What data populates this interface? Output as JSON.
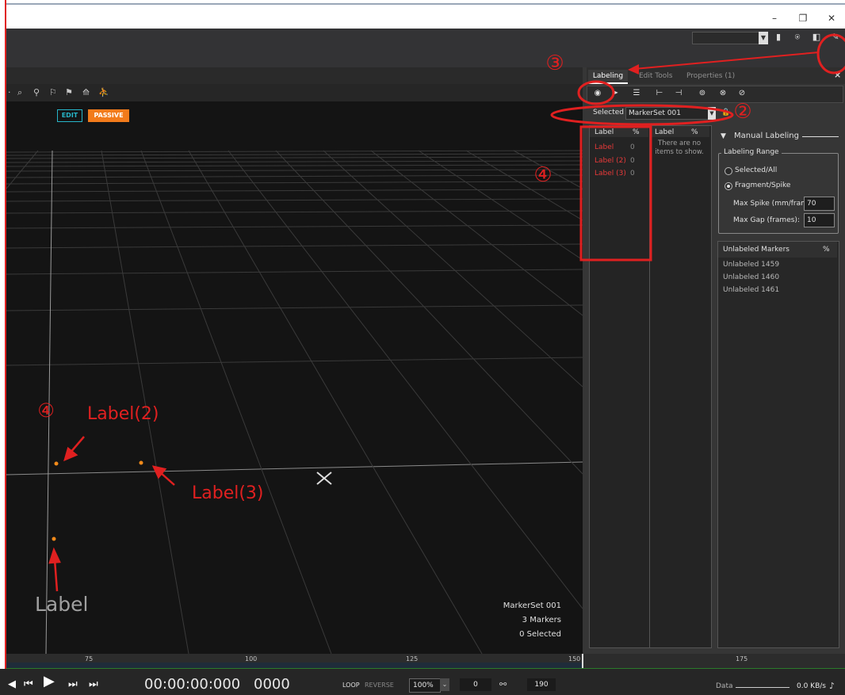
{
  "window": {
    "minimize_icon": "minimize-icon",
    "restore_icon": "restore-icon",
    "close_icon": "close-icon"
  },
  "viewport": {
    "edit_badge": "EDIT",
    "passive_badge": "PASSIVE",
    "marker_set_name": "MarkerSet 001",
    "marker_count": "3 Markers",
    "selected_count": "0 Selected"
  },
  "panel": {
    "tabs": [
      {
        "label": "Labeling"
      },
      {
        "label": "Edit Tools"
      },
      {
        "label": "Properties (1)"
      }
    ],
    "close": "×",
    "selected_label": "Selected",
    "selected_value": "MarkerSet 001",
    "label_list": {
      "header_label": "Label",
      "header_pct": "%",
      "rows": [
        {
          "label": "Label",
          "pct": "0"
        },
        {
          "label": "Label (2)",
          "pct": "0"
        },
        {
          "label": "Label (3)",
          "pct": "0"
        }
      ]
    },
    "secondary_list": {
      "header_label": "Label",
      "header_pct": "%",
      "empty_text": "There are no items to show."
    },
    "manual_labeling": {
      "title": "Manual Labeling",
      "range_title": "Labeling Range",
      "option_selected_all": "Selected/All",
      "option_fragment": "Fragment/Spike",
      "max_spike_label": "Max Spike (mm/frame):",
      "max_spike_value": "70",
      "max_gap_label": "Max Gap (frames):",
      "max_gap_value": "10"
    },
    "unlabeled": {
      "header": "Unlabeled Markers",
      "header_pct": "%",
      "rows": [
        "Unlabeled 1459",
        "Unlabeled 1460",
        "Unlabeled 1461"
      ]
    }
  },
  "timeline": {
    "ticks": [
      "75",
      "100",
      "125",
      "150",
      "175"
    ]
  },
  "transport": {
    "timecode": "00:00:00:000",
    "frame": "0000",
    "loop": "LOOP",
    "reverse": "REVERSE",
    "speed": "100%",
    "start_frame": "0",
    "end_frame": "190",
    "data_label": "Data",
    "data_rate": "0.0 KB/s"
  },
  "annotations": {
    "circle_2": "②",
    "circle_3": "③",
    "circle_4a": "④",
    "circle_4b": "④",
    "label2": "Label(2)",
    "label3": "Label(3)",
    "label1": "Label"
  },
  "colors": {
    "accent_edit": "#26b5c8",
    "accent_passive": "#f27b1b",
    "label_red": "#e83a3a",
    "annotation_red": "#e02020",
    "marker_orange": "#f28a1a"
  }
}
